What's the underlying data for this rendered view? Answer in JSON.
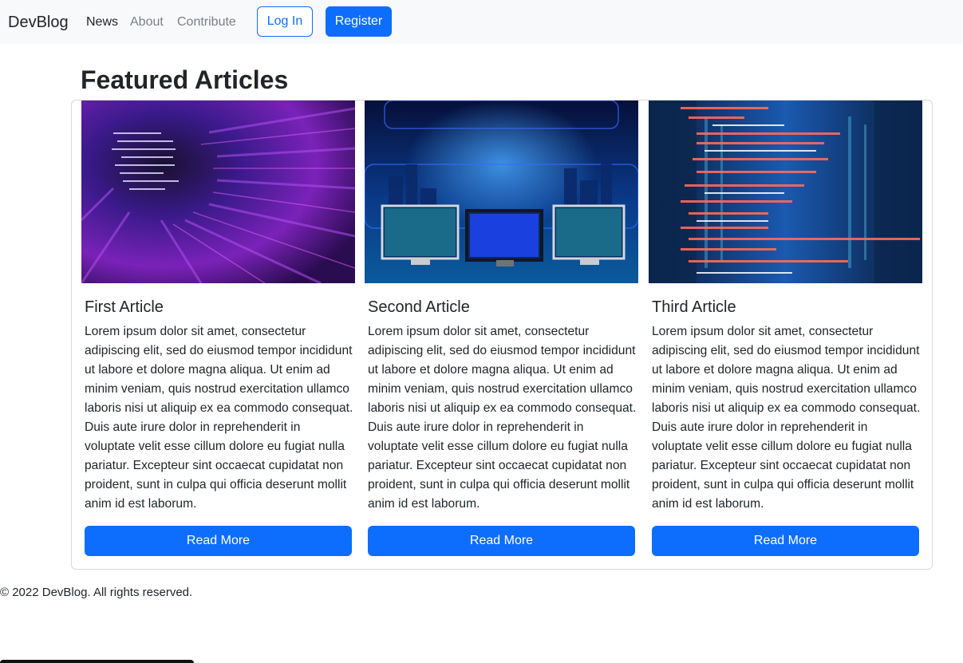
{
  "navbar": {
    "brand": "DevBlog",
    "links": [
      {
        "label": "News",
        "active": true
      },
      {
        "label": "About",
        "active": false
      },
      {
        "label": "Contribute",
        "active": false
      }
    ],
    "login_label": "Log In",
    "register_label": "Register"
  },
  "main": {
    "title": "Featured Articles",
    "articles": [
      {
        "title": "First Article",
        "image": "purple-code-blur-image",
        "text": "Lorem ipsum dolor sit amet, consectetur adipiscing elit, sed do eiusmod tempor incididunt ut labore et dolore magna aliqua. Ut enim ad minim veniam, quis nostrud exercitation ullamco laboris nisi ut aliquip ex ea commodo consequat. Duis aute irure dolor in reprehenderit in voluptate velit esse cillum dolore eu fugiat nulla pariatur. Excepteur sint occaecat cupidatat non proident, sunt in culpa qui officia deserunt mollit anim id est laborum.",
        "button_label": "Read More"
      },
      {
        "title": "Second Article",
        "image": "monitors-city-image",
        "text": "Lorem ipsum dolor sit amet, consectetur adipiscing elit, sed do eiusmod tempor incididunt ut labore et dolore magna aliqua. Ut enim ad minim veniam, quis nostrud exercitation ullamco laboris nisi ut aliquip ex ea commodo consequat. Duis aute irure dolor in reprehenderit in voluptate velit esse cillum dolore eu fugiat nulla pariatur. Excepteur sint occaecat cupidatat non proident, sunt in culpa qui officia deserunt mollit anim id est laborum.",
        "button_label": "Read More"
      },
      {
        "title": "Third Article",
        "image": "server-room-code-image",
        "text": "Lorem ipsum dolor sit amet, consectetur adipiscing elit, sed do eiusmod tempor incididunt ut labore et dolore magna aliqua. Ut enim ad minim veniam, quis nostrud exercitation ullamco laboris nisi ut aliquip ex ea commodo consequat. Duis aute irure dolor in reprehenderit in voluptate velit esse cillum dolore eu fugiat nulla pariatur. Excepteur sint occaecat cupidatat non proident, sunt in culpa qui officia deserunt mollit anim id est laborum.",
        "button_label": "Read More"
      }
    ]
  },
  "footer": {
    "text": "© 2022 DevBlog. All rights reserved."
  },
  "colors": {
    "primary": "#0d6efd",
    "navbar_bg": "#f8f9fa",
    "muted_link": "#7a7f84"
  }
}
